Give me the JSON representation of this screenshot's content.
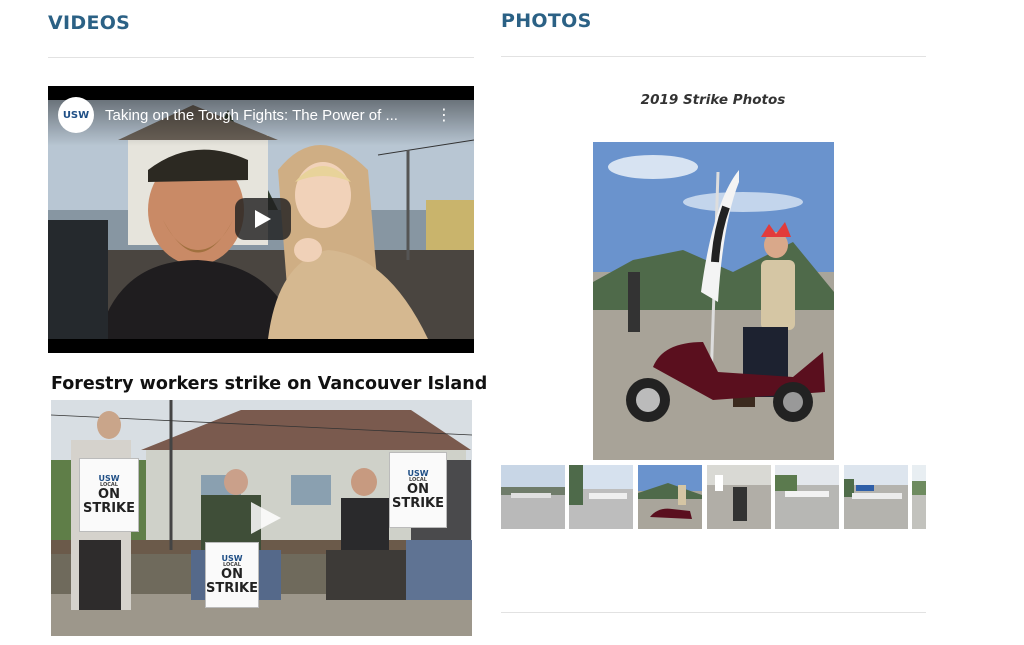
{
  "videos": {
    "heading": "VIDEOS",
    "embed": {
      "channel_logo": "USW",
      "title": "Taking on the Tough Fights: The Power of ...",
      "menu_icon": "kebab-vertical-icon",
      "play_icon": "play-icon"
    },
    "second": {
      "title": "Forestry workers strike on Vancouver Island",
      "sign_usw": "USW",
      "sign_local": "LOCAL",
      "sign_on": "ON",
      "sign_strike": "STRIKE",
      "play_icon": "play-icon"
    }
  },
  "photos": {
    "heading": "PHOTOS",
    "gallery_caption": "2019 Strike Photos",
    "thumbnail_count": 7
  },
  "colors": {
    "heading": "#2b6185",
    "rule": "#e2e2e2"
  }
}
